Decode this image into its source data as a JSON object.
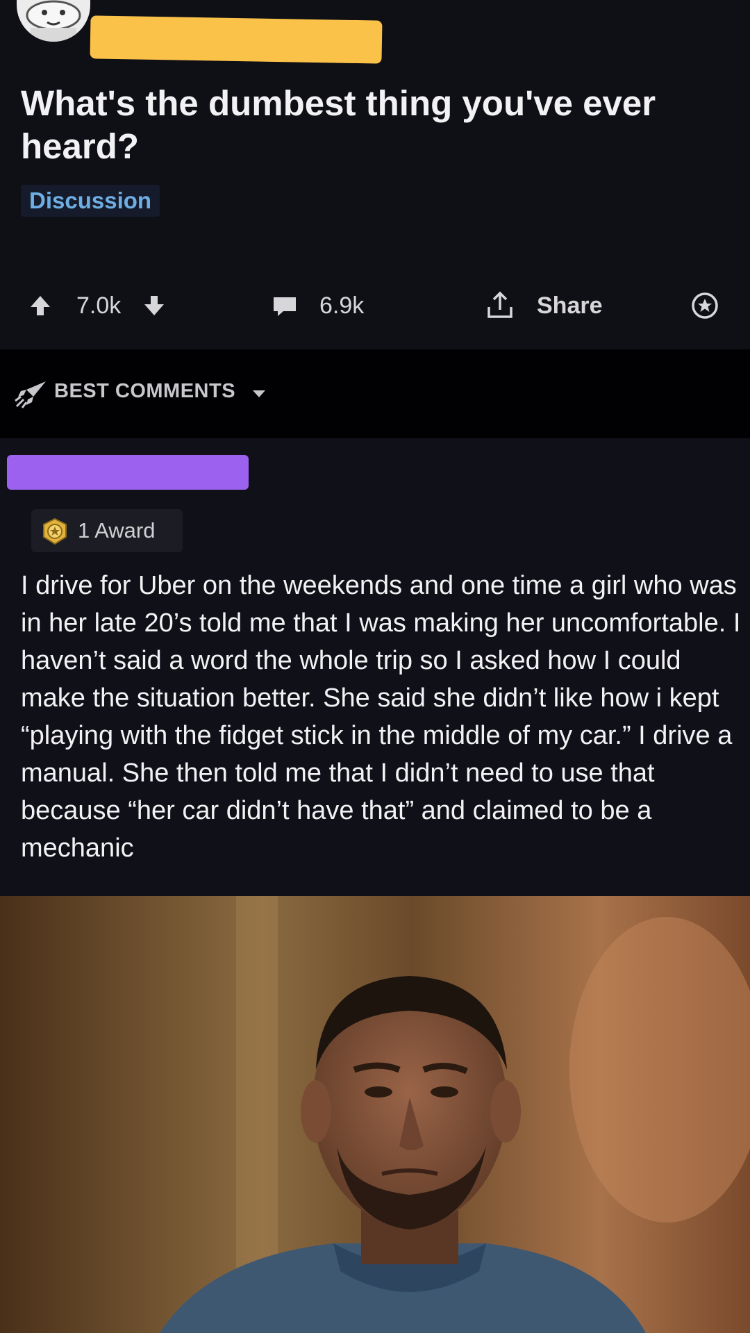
{
  "post": {
    "title": "What's the dumbest thing you've ever heard?",
    "flair": "Discussion",
    "score": "7.0k",
    "comments": "6.9k",
    "share_label": "Share"
  },
  "sort": {
    "label": "BEST COMMENTS"
  },
  "comment": {
    "award": "1 Award",
    "body": "I drive for Uber on the weekends and one time a girl who was in her late 20’s told me that I was making her uncomfortable. I haven’t said a word the whole trip so I asked how I could make the situation better. She said she didn’t like how i kept “playing with the fidget stick in the middle of my car.” I drive a manual. She then told me that I didn’t need to use that because “her car didn’t have that” and claimed to be a mechanic"
  },
  "colors": {
    "background": "#0f0f16",
    "username_redaction": "#fbc249",
    "commenter_redaction": "#9d61ef",
    "flair_text": "#6eaee4"
  },
  "icons": [
    "avatar",
    "upvote-icon",
    "downvote-icon",
    "comment-icon",
    "share-icon",
    "award-icon",
    "rocket-icon",
    "caret-down-icon",
    "gold-award-icon"
  ]
}
